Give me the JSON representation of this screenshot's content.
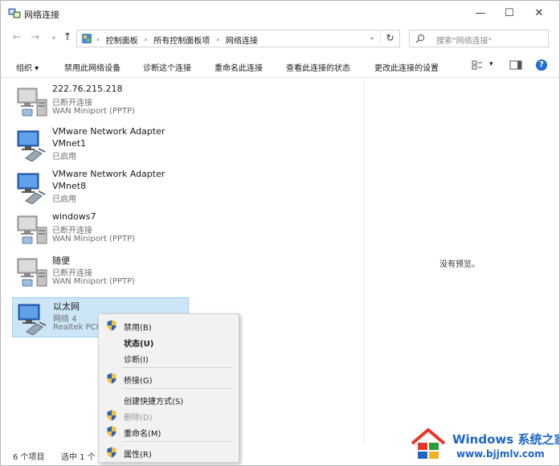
{
  "window": {
    "title": "网络连接",
    "minimize": "—",
    "maximize": "☐",
    "close": "✕"
  },
  "address": {
    "back": "←",
    "forward": "→",
    "recent": "▾",
    "up": "↑",
    "crumbs": [
      "控制面板",
      "所有控制面板项",
      "网络连接"
    ],
    "separator": "›",
    "dropdown": "⌄",
    "refresh": "↻",
    "search_placeholder": "搜索\"网络连接\""
  },
  "toolbar": {
    "organize": "组织 ▾",
    "disable": "禁用此网络设备",
    "diagnose": "诊断这个连接",
    "rename": "重命名此连接",
    "status": "查看此连接的状态",
    "settings": "更改此连接的设置",
    "view_dd": "▾",
    "help": "?"
  },
  "connections": [
    {
      "name": "222.76.215.218",
      "status": "已断开连接",
      "device": "WAN Miniport (PPTP)",
      "icon": "vpn-connection-icon"
    },
    {
      "name": "VMware Network Adapter",
      "status": "VMnet1",
      "device": "已启用",
      "icon": "network-adapter-icon"
    },
    {
      "name": "VMware Network Adapter",
      "status": "VMnet8",
      "device": "已启用",
      "icon": "network-adapter-icon"
    },
    {
      "name": "windows7",
      "status": "已断开连接",
      "device": "WAN Miniport (PPTP)",
      "icon": "vpn-connection-icon"
    },
    {
      "name": "随便",
      "status": "已断开连接",
      "device": "WAN Miniport (PPTP)",
      "icon": "vpn-connection-icon"
    },
    {
      "name": "以太网",
      "status": "网络 4",
      "device": "Realtek PCI",
      "icon": "ethernet-adapter-icon"
    }
  ],
  "preview": {
    "empty_text": "没有预览。"
  },
  "status_bar": {
    "count": "6 个项目",
    "selected": "选中 1 个"
  },
  "context_menu": {
    "items": [
      {
        "label": "禁用(B)",
        "shield": true
      },
      {
        "label": "状态(U)",
        "bold": true
      },
      {
        "label": "诊断(I)"
      },
      {
        "label": "桥接(G)",
        "shield": true
      },
      {
        "label": "创建快捷方式(S)"
      },
      {
        "label": "删除(D)",
        "shield": true,
        "disabled": true
      },
      {
        "label": "重命名(M)",
        "shield": true
      },
      {
        "label": "属性(R)",
        "shield": true
      }
    ]
  },
  "watermark": {
    "title": "Windows",
    "title_cn": "系统之家",
    "url": "www.bjjmlv.com"
  },
  "colors": {
    "selection": "#cce6f7",
    "accent": "#1f64c7",
    "help": "#1e6fd0"
  }
}
